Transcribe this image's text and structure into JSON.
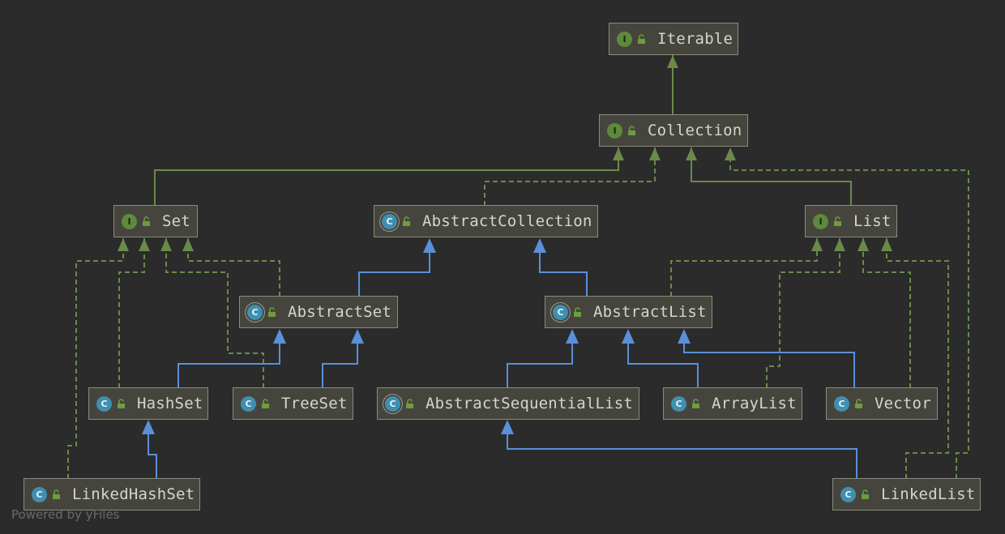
{
  "nodes": [
    {
      "id": "Iterable",
      "kind": "interface",
      "badge": "I"
    },
    {
      "id": "Collection",
      "kind": "interface",
      "badge": "I"
    },
    {
      "id": "Set",
      "kind": "interface",
      "badge": "I"
    },
    {
      "id": "AbstractCollection",
      "kind": "abstract-class",
      "badge": "C"
    },
    {
      "id": "List",
      "kind": "interface",
      "badge": "I"
    },
    {
      "id": "AbstractSet",
      "kind": "abstract-class",
      "badge": "C"
    },
    {
      "id": "AbstractList",
      "kind": "abstract-class",
      "badge": "C"
    },
    {
      "id": "HashSet",
      "kind": "class",
      "badge": "C"
    },
    {
      "id": "TreeSet",
      "kind": "class",
      "badge": "C"
    },
    {
      "id": "AbstractSequentialList",
      "kind": "abstract-class",
      "badge": "C"
    },
    {
      "id": "ArrayList",
      "kind": "class",
      "badge": "C"
    },
    {
      "id": "Vector",
      "kind": "class",
      "badge": "C"
    },
    {
      "id": "LinkedHashSet",
      "kind": "class",
      "badge": "C"
    },
    {
      "id": "LinkedList",
      "kind": "class",
      "badge": "C"
    }
  ],
  "edges": [
    {
      "from": "Collection",
      "to": "Iterable",
      "type": "extends-interface"
    },
    {
      "from": "Set",
      "to": "Collection",
      "type": "extends-interface"
    },
    {
      "from": "AbstractCollection",
      "to": "Collection",
      "type": "implements"
    },
    {
      "from": "List",
      "to": "Collection",
      "type": "extends-interface"
    },
    {
      "from": "LinkedList",
      "to": "Collection",
      "type": "implements"
    },
    {
      "from": "AbstractSet",
      "to": "AbstractCollection",
      "type": "extends-class"
    },
    {
      "from": "AbstractList",
      "to": "AbstractCollection",
      "type": "extends-class"
    },
    {
      "from": "AbstractSet",
      "to": "Set",
      "type": "implements"
    },
    {
      "from": "HashSet",
      "to": "Set",
      "type": "implements"
    },
    {
      "from": "TreeSet",
      "to": "Set",
      "type": "implements"
    },
    {
      "from": "LinkedHashSet",
      "to": "Set",
      "type": "implements"
    },
    {
      "from": "HashSet",
      "to": "AbstractSet",
      "type": "extends-class"
    },
    {
      "from": "TreeSet",
      "to": "AbstractSet",
      "type": "extends-class"
    },
    {
      "from": "LinkedHashSet",
      "to": "HashSet",
      "type": "extends-class"
    },
    {
      "from": "AbstractList",
      "to": "List",
      "type": "implements"
    },
    {
      "from": "ArrayList",
      "to": "List",
      "type": "implements"
    },
    {
      "from": "Vector",
      "to": "List",
      "type": "implements"
    },
    {
      "from": "LinkedList",
      "to": "List",
      "type": "implements"
    },
    {
      "from": "AbstractSequentialList",
      "to": "AbstractList",
      "type": "extends-class"
    },
    {
      "from": "ArrayList",
      "to": "AbstractList",
      "type": "extends-class"
    },
    {
      "from": "Vector",
      "to": "AbstractList",
      "type": "extends-class"
    },
    {
      "from": "LinkedList",
      "to": "AbstractSequentialList",
      "type": "extends-class"
    }
  ],
  "colors": {
    "background": "#2b2b2b",
    "node_fill": "#45453d",
    "node_border": "#8a8a7e",
    "interface_edge": "#6a8a4a",
    "class_edge": "#5b8fd9",
    "interface_badge": "#5e8a3c",
    "class_badge": "#3f8fb0",
    "text": "#d4d4d4"
  },
  "icons": {
    "visibility": "public-lock-icon",
    "interface": "interface-badge-icon",
    "class": "class-badge-icon"
  },
  "footer": "Powered by yFiles"
}
